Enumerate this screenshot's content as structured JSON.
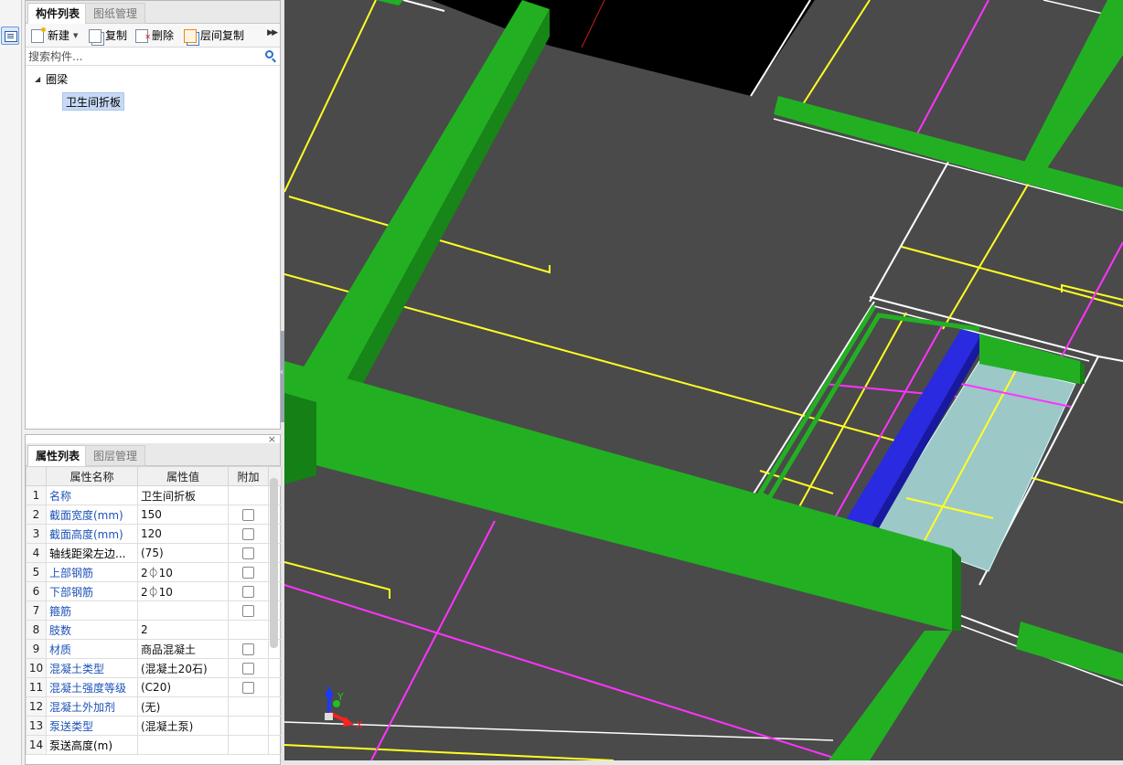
{
  "component_panel": {
    "tabs": [
      {
        "label": "构件列表",
        "active": true
      },
      {
        "label": "图纸管理",
        "active": false
      }
    ],
    "toolbar": {
      "new_label": "新建",
      "copy_label": "复制",
      "delete_label": "删除",
      "floor_copy_label": "层间复制"
    },
    "search": {
      "placeholder": "搜索构件..."
    },
    "tree": {
      "group_label": "圈梁",
      "item_label": "卫生间折板"
    }
  },
  "property_panel": {
    "tabs": [
      {
        "label": "属性列表",
        "active": true
      },
      {
        "label": "图层管理",
        "active": false
      }
    ],
    "columns": [
      "属性名称",
      "属性值",
      "附加"
    ],
    "rows": [
      {
        "no": "1",
        "name": "名称",
        "value": "卫生间折板",
        "blue": true,
        "checkbox": false
      },
      {
        "no": "2",
        "name": "截面宽度(mm)",
        "value": "150",
        "blue": true,
        "checkbox": true
      },
      {
        "no": "3",
        "name": "截面高度(mm)",
        "value": "120",
        "blue": true,
        "checkbox": true
      },
      {
        "no": "4",
        "name": "轴线距梁左边...",
        "value": "(75)",
        "blue": false,
        "checkbox": true
      },
      {
        "no": "5",
        "name": "上部钢筋",
        "value": "2⏀10",
        "blue": true,
        "checkbox": true
      },
      {
        "no": "6",
        "name": "下部钢筋",
        "value": "2⏀10",
        "blue": true,
        "checkbox": true
      },
      {
        "no": "7",
        "name": "箍筋",
        "value": "",
        "blue": true,
        "checkbox": true
      },
      {
        "no": "8",
        "name": "肢数",
        "value": "2",
        "blue": true,
        "checkbox": false
      },
      {
        "no": "9",
        "name": "材质",
        "value": "商品混凝土",
        "blue": true,
        "checkbox": true
      },
      {
        "no": "10",
        "name": "混凝土类型",
        "value": "(混凝土20石)",
        "blue": true,
        "checkbox": true
      },
      {
        "no": "11",
        "name": "混凝土强度等级",
        "value": "(C20)",
        "blue": true,
        "checkbox": true
      },
      {
        "no": "12",
        "name": "混凝土外加剂",
        "value": "(无)",
        "blue": true,
        "checkbox": false
      },
      {
        "no": "13",
        "name": "泵送类型",
        "value": "(混凝土泵)",
        "blue": true,
        "checkbox": false
      },
      {
        "no": "14",
        "name": "泵送高度(m)",
        "value": "",
        "blue": false,
        "checkbox": false
      }
    ]
  },
  "viewport": {
    "axis_labels": {
      "x": "X",
      "y": "Y",
      "z": "Z"
    },
    "colors": {
      "background": "#4a4a4a",
      "beam_green": "#22b022",
      "beam_blue": "#2a2ae0",
      "slab_cyan": "#9cc8c8",
      "line_yellow": "#ffff22",
      "line_magenta": "#ff33ff",
      "line_white": "#ffffff"
    }
  }
}
